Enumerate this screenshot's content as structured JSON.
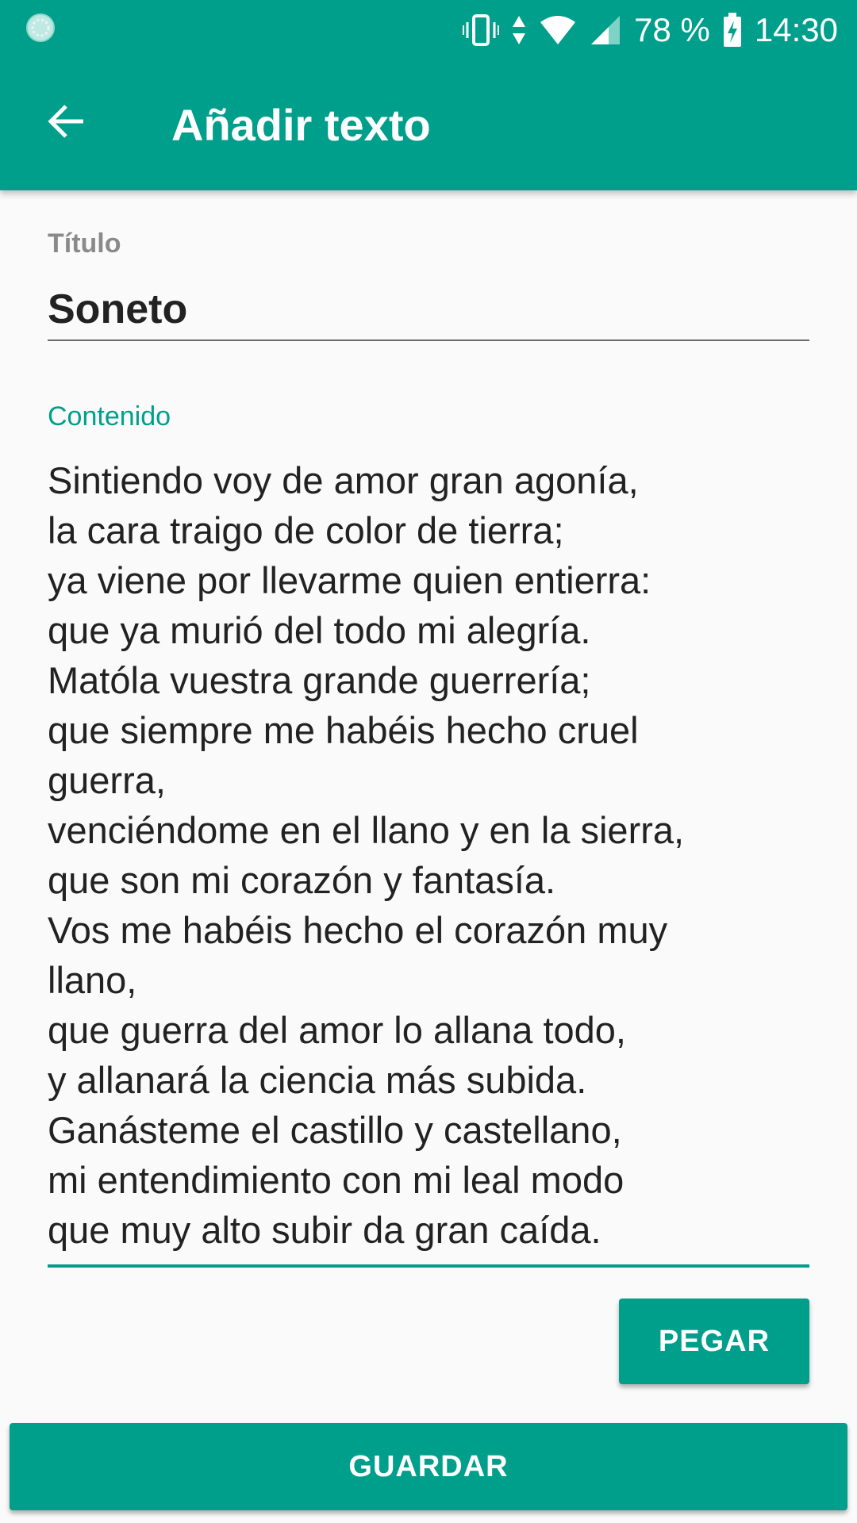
{
  "status_bar": {
    "battery_percent": "78 %",
    "time": "14:30",
    "icons": [
      "loading-circle-icon",
      "vibrate-icon",
      "data-arrows-icon",
      "wifi-icon",
      "cell-signal-icon",
      "battery-charging-icon"
    ]
  },
  "toolbar": {
    "title": "Añadir texto",
    "back_icon": "arrow-back-icon"
  },
  "form": {
    "title_label": "Título",
    "title_value": "Soneto",
    "content_label": "Contenido",
    "content_lines": [
      "Sintiendo voy de amor gran agonía,",
      "la cara traigo de color de tierra;",
      "ya viene por llevarme quien entierra:",
      "que ya murió del todo mi alegría.",
      "Matóla vuestra grande guerrería;",
      "que siempre me habéis hecho cruel",
      "guerra,",
      "venciéndome en el llano y en la sierra,",
      "que son mi corazón y fantasía.",
      "Vos me habéis hecho el corazón muy",
      "llano,",
      "que guerra del amor lo allana todo,",
      "y allanará la ciencia más subida.",
      "Ganásteme el castillo y castellano,",
      "mi entendimiento con mi leal modo",
      "que muy alto subir da gran caída."
    ]
  },
  "buttons": {
    "paste_label": "PEGAR",
    "save_label": "GUARDAR"
  },
  "colors": {
    "primary": "#009f8c",
    "background": "#fafafa",
    "text": "#222222",
    "label_gray": "#8a8a8a"
  }
}
